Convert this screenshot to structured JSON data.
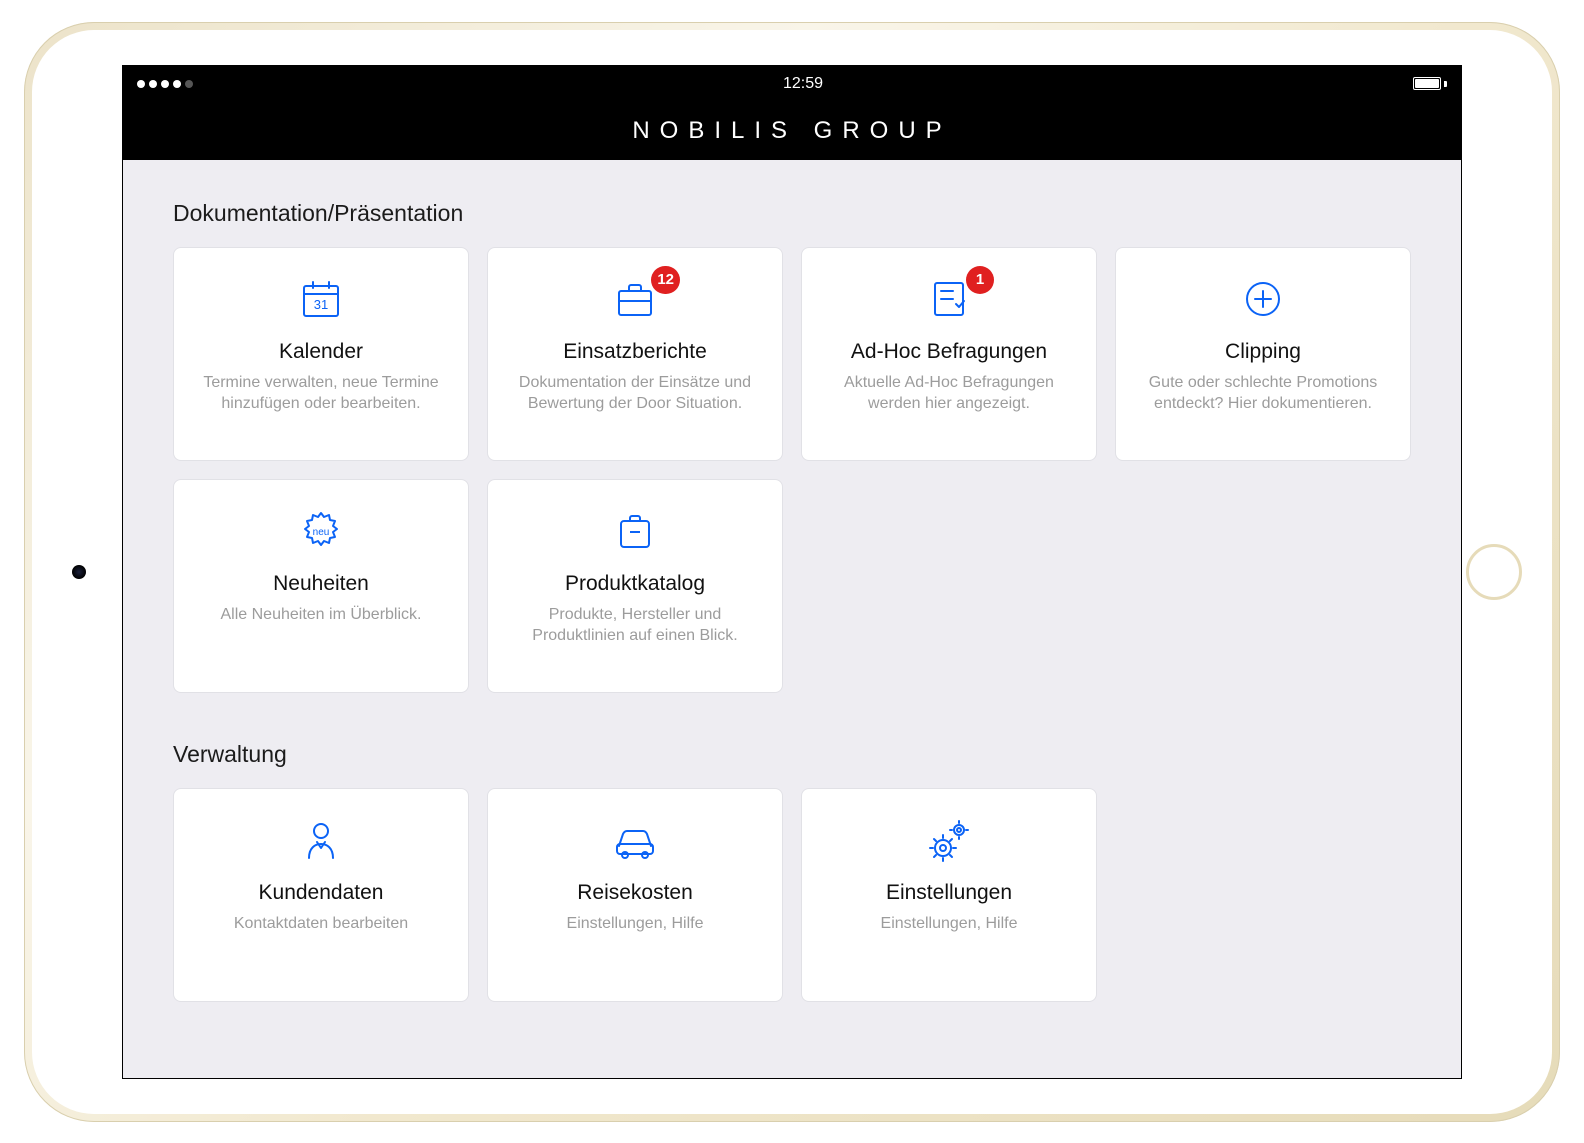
{
  "status": {
    "time": "12:59"
  },
  "app_title": "NOBILIS GROUP",
  "sections": [
    {
      "title": "Dokumentation/Präsentation",
      "cards": [
        {
          "title": "Kalender",
          "sub": "Termine verwalten, neue Termine hinzufügen oder bearbeiten.",
          "icon": "calendar",
          "badge": null
        },
        {
          "title": "Einsatzberichte",
          "sub": "Dokumentation der Einsätze und Bewertung der Door Situation.",
          "icon": "briefcase",
          "badge": "12"
        },
        {
          "title": "Ad-Hoc Befragungen",
          "sub": "Aktuelle Ad-Hoc Befragungen werden hier angezeigt.",
          "icon": "checklist",
          "badge": "1"
        },
        {
          "title": "Clipping",
          "sub": "Gute oder schlechte Promotions entdeckt? Hier dokumentieren.",
          "icon": "plus-circle",
          "badge": null
        },
        {
          "title": "Neuheiten",
          "sub": "Alle Neuheiten im Überblick.",
          "icon": "neu-burst",
          "badge": null
        },
        {
          "title": "Produktkatalog",
          "sub": "Produkte, Hersteller und Produktlinien auf einen Blick.",
          "icon": "catalog",
          "badge": null
        }
      ]
    },
    {
      "title": "Verwaltung",
      "cards": [
        {
          "title": "Kundendaten",
          "sub": "Kontaktdaten bearbeiten",
          "icon": "user",
          "badge": null
        },
        {
          "title": "Reisekosten",
          "sub": "Einstellungen, Hilfe",
          "icon": "car",
          "badge": null
        },
        {
          "title": "Einstellungen",
          "sub": "Einstellungen, Hilfe",
          "icon": "gears",
          "badge": null
        }
      ]
    }
  ],
  "icons": {
    "neu_text": "neu"
  }
}
